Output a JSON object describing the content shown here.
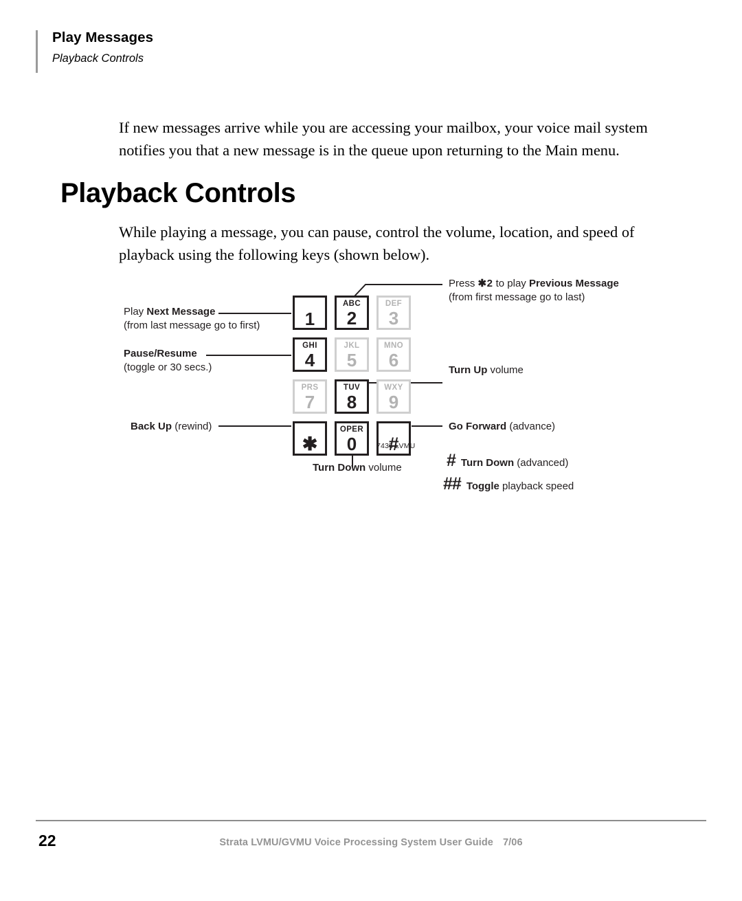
{
  "header": {
    "title": "Play Messages",
    "subtitle": "Playback Controls"
  },
  "content": {
    "intro_paragraph": "If new messages arrive while you are accessing your mailbox, your voice mail system notifies you that a new message is in the queue upon returning to the Main menu.",
    "section_heading": "Playback Controls",
    "lead_paragraph": "While playing a message, you can pause, control the volume, location, and speed of playback using the following keys (shown below)."
  },
  "keypad": {
    "model_label": "7435 LVMU",
    "keys": [
      {
        "digit": "1",
        "letters": "",
        "active": true
      },
      {
        "digit": "2",
        "letters": "ABC",
        "active": true
      },
      {
        "digit": "3",
        "letters": "DEF",
        "active": false
      },
      {
        "digit": "4",
        "letters": "GHI",
        "active": true
      },
      {
        "digit": "5",
        "letters": "JKL",
        "active": false
      },
      {
        "digit": "6",
        "letters": "MNO",
        "active": false
      },
      {
        "digit": "7",
        "letters": "PRS",
        "active": false
      },
      {
        "digit": "8",
        "letters": "TUV",
        "active": true
      },
      {
        "digit": "9",
        "letters": "WXY",
        "active": false
      },
      {
        "digit": "✱",
        "letters": "",
        "active": true
      },
      {
        "digit": "0",
        "letters": "OPER",
        "active": true
      },
      {
        "digit": "#",
        "letters": "",
        "active": true
      }
    ]
  },
  "callouts": {
    "next_message": {
      "prefix": "Play ",
      "bold": "Next Message",
      "sub": "(from last message go to first)"
    },
    "pause_resume": {
      "bold": "Pause/Resume",
      "sub": "(toggle or 30 secs.)"
    },
    "back_up": {
      "bold": "Back Up",
      "suffix": " (rewind)"
    },
    "previous_message": {
      "prefix": "Press ",
      "keys": "✱2",
      "middle": " to play ",
      "bold": "Previous Message",
      "sub": "(from first message go to last)"
    },
    "turn_up": {
      "bold": "Turn Up",
      "suffix": " volume"
    },
    "go_forward": {
      "bold": "Go Forward",
      "suffix": " (advance)"
    },
    "turn_down_volume": {
      "bold": "Turn Down",
      "suffix": " volume"
    },
    "turn_down_advanced": {
      "glyph": "#",
      "bold": "Turn Down",
      "suffix": " (advanced)"
    },
    "toggle_speed": {
      "glyph": "##",
      "bold": "Toggle",
      "suffix": " playback speed"
    }
  },
  "footer": {
    "page_number": "22",
    "guide_title": "Strata LVMU/GVMU Voice Processing System User Guide",
    "date": "7/06"
  }
}
